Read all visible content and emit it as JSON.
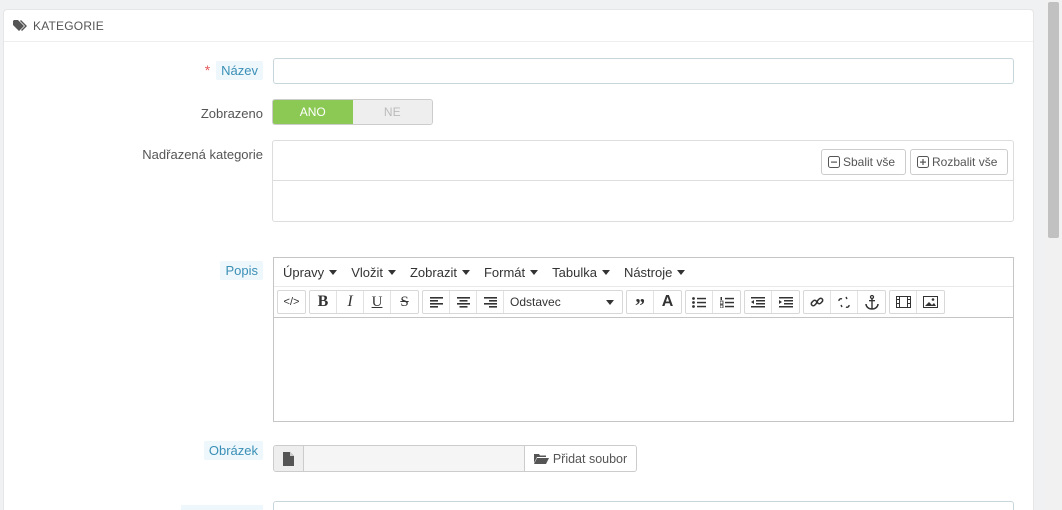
{
  "panel": {
    "title": "KATEGORIE"
  },
  "fields": {
    "name_label": "Název",
    "required_mark": "*",
    "displayed_label": "Zobrazeno",
    "toggle_yes": "ANO",
    "toggle_no": "NE",
    "parent_label": "Nadřazená kategorie",
    "collapse_all": "Sbalit vše",
    "expand_all": "Rozbalit vše",
    "desc_label": "Popis",
    "image_label": "Obrázek",
    "add_file": "Přidat soubor"
  },
  "editor": {
    "menus": [
      "Úpravy",
      "Vložit",
      "Zobrazit",
      "Formát",
      "Tabulka",
      "Nástroje"
    ],
    "format_select": "Odstavec"
  },
  "colors": {
    "accent": "#8bc954",
    "hint_bg": "#edf7fc",
    "hint_text": "#3b8fb6",
    "required": "#e5595b"
  }
}
